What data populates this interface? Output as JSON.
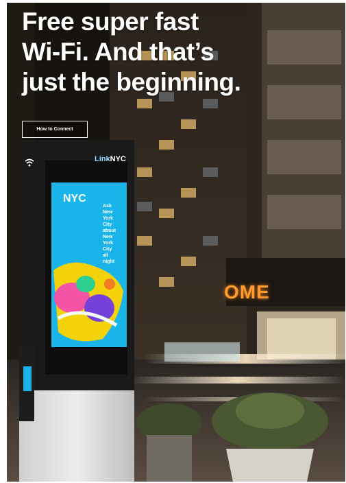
{
  "headline": {
    "lines": [
      "Free super fast",
      "Wi-Fi. And that’s",
      "just the beginning."
    ]
  },
  "cta": {
    "label": "How to Connect"
  },
  "kiosk": {
    "brand_prefix": "Link",
    "brand_suffix": "NYC",
    "logo_text": "NYC",
    "screen_lines": [
      "Ask",
      "New",
      "York",
      "City",
      "about",
      "New",
      "York",
      "City",
      "all",
      "night"
    ]
  },
  "storefront_sign": "OME",
  "colors": {
    "kiosk_screen": "#19b4ea",
    "sign_orange": "#ff9a2e",
    "night_sky": "#15120f"
  },
  "icons": [
    "wifi-icon"
  ]
}
